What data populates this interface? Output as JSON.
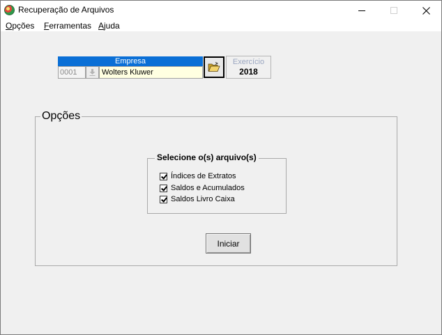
{
  "window": {
    "title": "Recuperação de Arquivos",
    "icon": "app-icon",
    "controls": {
      "minimize": "minimize-icon",
      "maximize": "maximize-icon",
      "close": "close-icon"
    }
  },
  "menu": [
    {
      "accel": "O",
      "rest": "pções"
    },
    {
      "accel": "F",
      "rest": "erramentas"
    },
    {
      "accel": "A",
      "rest": "juda"
    }
  ],
  "empresa": {
    "header": "Empresa",
    "code": "0001",
    "name": "Wolters Kluwer",
    "spin_icon": "download-arrow-icon",
    "folder_icon": "open-folder-icon"
  },
  "exercicio": {
    "label": "Exercício",
    "year": "2018"
  },
  "options": {
    "legend": "Opções",
    "files_legend": "Selecione o(s) arquivo(s)",
    "files": [
      {
        "label": "Índices de Extratos",
        "checked": true
      },
      {
        "label": "Saldos e Acumulados",
        "checked": true
      },
      {
        "label": "Saldos Livro Caixa",
        "checked": true
      }
    ],
    "start_label": "Iniciar"
  }
}
